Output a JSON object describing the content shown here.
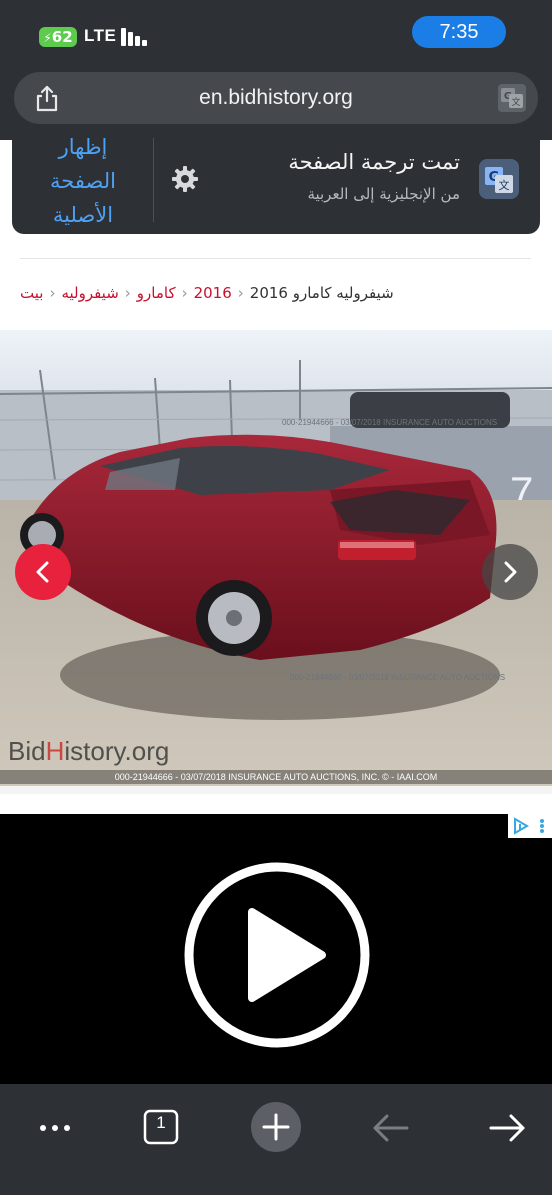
{
  "status_bar": {
    "battery_level": "62",
    "network": "LTE",
    "time": "7:35"
  },
  "browser": {
    "url": "en.bidhistory.org",
    "tab_count": "1"
  },
  "translate_bar": {
    "title": "تمت ترجمة الصفحة",
    "subtitle": "من الإنجليزية إلى العربية",
    "show_original_line1": "إظهار",
    "show_original_line2": "الصفحة",
    "show_original_line3": "الأصلية"
  },
  "breadcrumb": {
    "home": "بيت",
    "make": "شيفروليه",
    "model": "كامارو",
    "year": "2016",
    "current": "شيفروليه كامارو 2016"
  },
  "photo": {
    "watermark_prefix": "Bid",
    "watermark_mid": "H",
    "watermark_suffix": "istory.org",
    "caption": "000-21944666 - 03/07/2018 INSURANCE AUTO AUCTIONS, INC. © - IAAI.COM"
  },
  "ad": {
    "adchoices_icon": "adchoices-icon",
    "info_icon": "info-icon"
  },
  "colors": {
    "accent_red": "#e8223c",
    "link_blue": "#4ea1f3",
    "chrome_dark": "#2d3034",
    "time_pill": "#1a7ee6"
  }
}
